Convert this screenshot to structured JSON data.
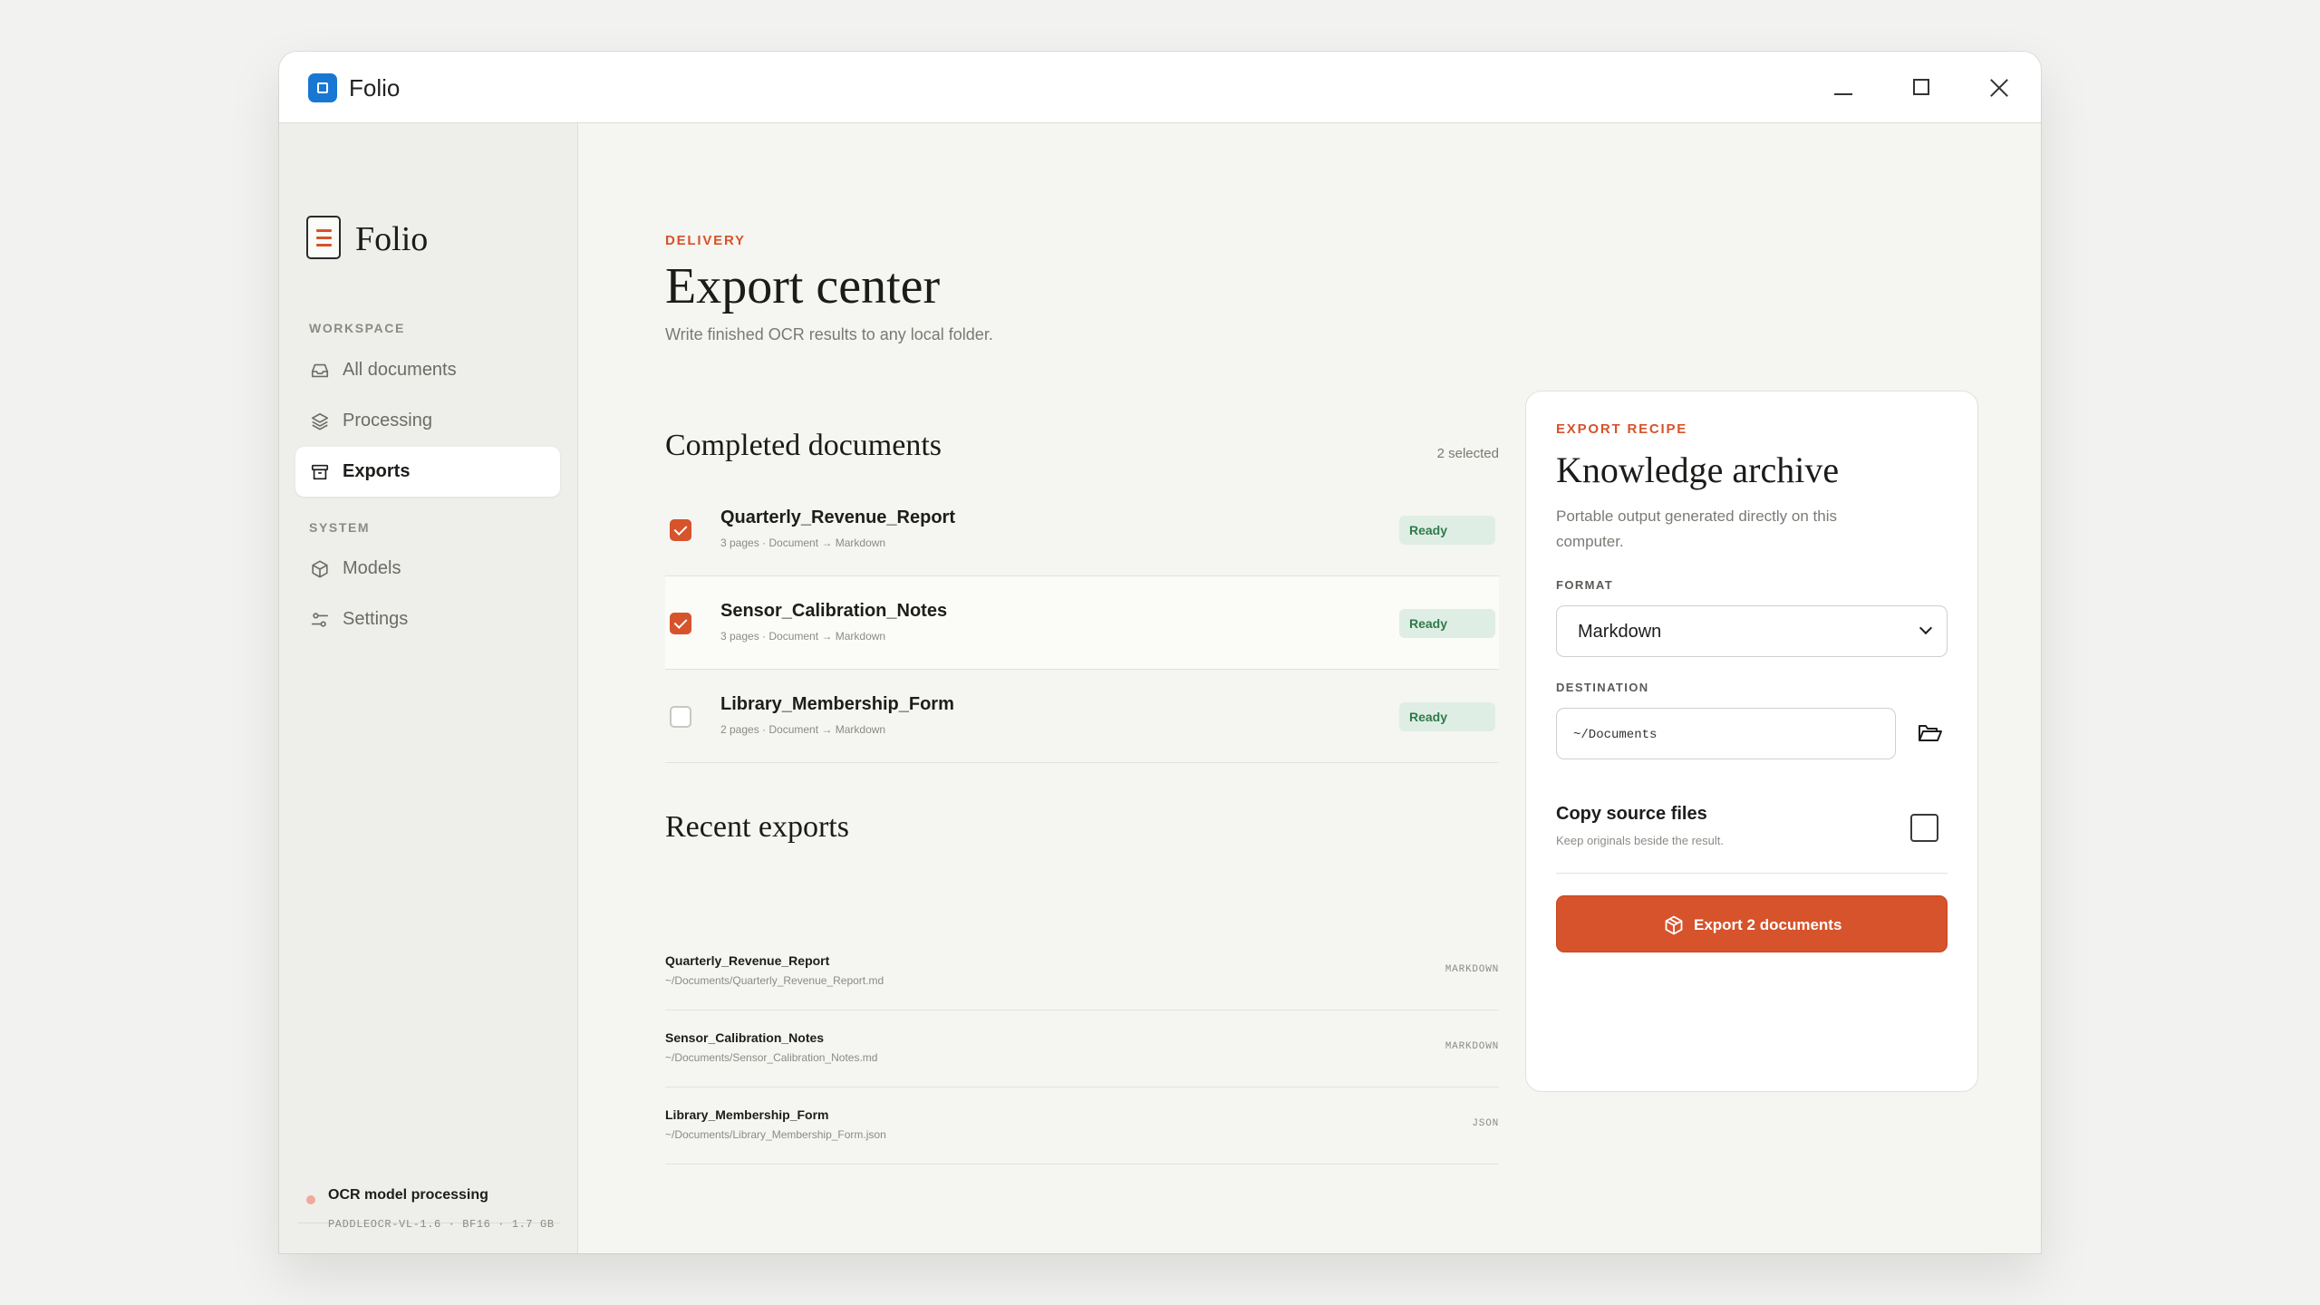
{
  "window": {
    "title": "Folio"
  },
  "sidebar": {
    "brand": "Folio",
    "workspace_label": "WORKSPACE",
    "system_label": "SYSTEM",
    "items": [
      {
        "label": "All documents",
        "icon": "inbox-icon"
      },
      {
        "label": "Processing",
        "icon": "layers-icon"
      },
      {
        "label": "Exports",
        "icon": "archive-icon",
        "active": true
      },
      {
        "label": "Models",
        "icon": "cube-icon"
      },
      {
        "label": "Settings",
        "icon": "sliders-icon"
      }
    ],
    "status": {
      "title": "OCR model processing",
      "detail": "PADDLEOCR-VL-1.6 · BF16 · 1.7 GB"
    }
  },
  "main": {
    "eyebrow": "DELIVERY",
    "title": "Export center",
    "subtitle": "Write finished OCR results to any local folder.",
    "completed": {
      "heading": "Completed documents",
      "selected": "2 selected",
      "rows": [
        {
          "name": "Quarterly_Revenue_Report",
          "meta": "3 pages · Document → Markdown",
          "status": "Ready",
          "checked": true
        },
        {
          "name": "Sensor_Calibration_Notes",
          "meta": "3 pages · Document → Markdown",
          "status": "Ready",
          "checked": true
        },
        {
          "name": "Library_Membership_Form",
          "meta": "2 pages · Document → Markdown",
          "status": "Ready",
          "checked": false
        }
      ]
    },
    "recent": {
      "heading": "Recent exports",
      "rows": [
        {
          "name": "Quarterly_Revenue_Report",
          "path": "~/Documents/Quarterly_Revenue_Report.md",
          "format": "MARKDOWN"
        },
        {
          "name": "Sensor_Calibration_Notes",
          "path": "~/Documents/Sensor_Calibration_Notes.md",
          "format": "MARKDOWN"
        },
        {
          "name": "Library_Membership_Form",
          "path": "~/Documents/Library_Membership_Form.json",
          "format": "JSON"
        }
      ]
    }
  },
  "recipe": {
    "eyebrow": "EXPORT RECIPE",
    "title": "Knowledge archive",
    "description": "Portable output generated directly on this computer.",
    "format_label": "FORMAT",
    "format_value": "Markdown",
    "destination_label": "DESTINATION",
    "destination_value": "~/Documents",
    "copy_title": "Copy source files",
    "copy_sub": "Keep originals beside the result.",
    "copy_checked": false,
    "export_button": "Export 2 documents"
  },
  "colors": {
    "accent": "#d6532b",
    "ready_bg": "#dfeee4",
    "ready_text": "#2f7a4b",
    "app_icon": "#1877d2"
  }
}
